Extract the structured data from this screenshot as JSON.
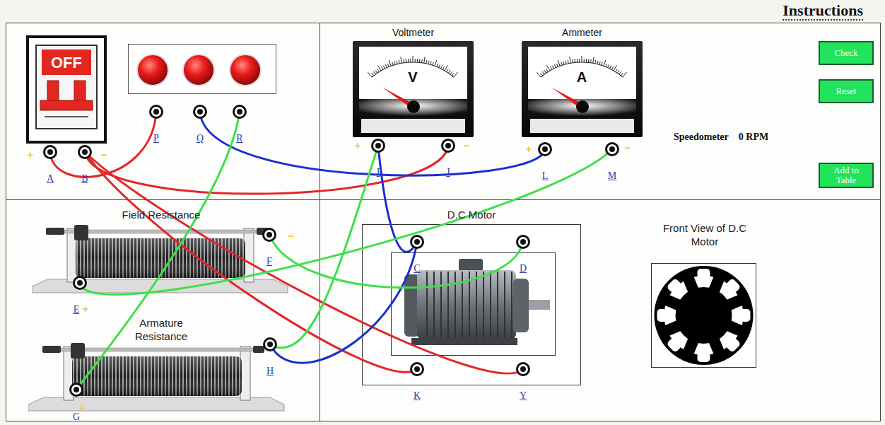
{
  "header": {
    "instructions": "Instructions"
  },
  "breaker": {
    "label": "OFF",
    "on": false
  },
  "lamps": [
    {
      "lit": true
    },
    {
      "lit": true
    },
    {
      "lit": true
    }
  ],
  "terminals": [
    {
      "label": "A",
      "sign": "+"
    },
    {
      "label": "B",
      "sign": "−"
    },
    {
      "label": "P"
    },
    {
      "label": "Q"
    },
    {
      "label": "R"
    },
    {
      "label": "I",
      "sign": "+"
    },
    {
      "label": "J",
      "sign": "−"
    },
    {
      "label": "L",
      "sign": "+"
    },
    {
      "label": "M",
      "sign": "−"
    },
    {
      "label": "F",
      "sign": "−"
    },
    {
      "label": "E",
      "sign": "+"
    },
    {
      "label": "H"
    },
    {
      "label": "G",
      "sign": "+"
    },
    {
      "label": "C"
    },
    {
      "label": "D"
    },
    {
      "label": "K"
    },
    {
      "label": "Y"
    }
  ],
  "meters": [
    {
      "title": "Voltmeter",
      "symbol": "V",
      "level": 0
    },
    {
      "title": "Ammeter",
      "symbol": "A",
      "level": 0
    }
  ],
  "rheostats": [
    {
      "title": "Field Resistance"
    },
    {
      "title": "Armature Resistance"
    }
  ],
  "motor": {
    "title": "D.C Motor"
  },
  "frontView": {
    "title": "Front View of D.C Motor"
  },
  "speedometer": {
    "label": "Speedometer",
    "reading": "0 RPM"
  },
  "buttons": [
    {
      "label": "Check"
    },
    {
      "label": "Reset"
    },
    {
      "label": "Add to Table"
    }
  ],
  "wires": [
    {
      "from": "A",
      "to": "P",
      "color": "#e3262b"
    },
    {
      "from": "B",
      "to": "J",
      "color": "#e3262b"
    },
    {
      "from": "B",
      "to": "K",
      "color": "#e3262b"
    },
    {
      "from": "B",
      "to": "Y",
      "color": "#e3262b"
    },
    {
      "from": "Q",
      "to": "L",
      "color": "#1a2fcf"
    },
    {
      "from": "I",
      "to": "C",
      "color": "#1a2fcf"
    },
    {
      "from": "C",
      "to": "H",
      "color": "#1a2fcf"
    },
    {
      "from": "R",
      "to": "G",
      "color": "#3ee04a"
    },
    {
      "from": "I",
      "to": "H",
      "color": "#3ee04a"
    },
    {
      "from": "M",
      "to": "E",
      "color": "#3ee04a"
    },
    {
      "from": "F",
      "to": "D",
      "color": "#3ee04a"
    }
  ]
}
